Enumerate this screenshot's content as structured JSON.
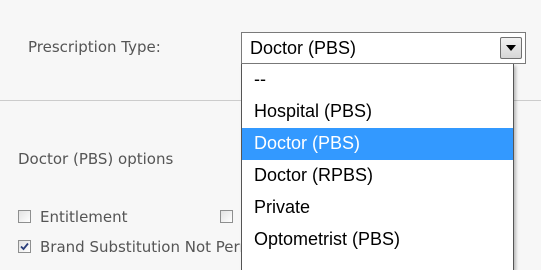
{
  "form": {
    "prescription_type_label": "Prescription Type:",
    "prescription_type_value": "Doctor (PBS)",
    "options_heading": "Doctor (PBS) options"
  },
  "dropdown": {
    "options": [
      "--",
      "Hospital (PBS)",
      "Doctor (PBS)",
      "Doctor (RPBS)",
      "Private",
      "Optometrist (PBS)"
    ],
    "selected_index": 2,
    "highlight_color": "#3399ff"
  },
  "checkboxes": [
    {
      "label": "Entitlement",
      "checked": false
    },
    {
      "label": "",
      "checked": false
    },
    {
      "label": "Brand Substitution Not Permitted",
      "checked": true
    }
  ],
  "icons": {
    "select_arrow": "chevron-down-icon",
    "check": "checkmark-icon"
  }
}
